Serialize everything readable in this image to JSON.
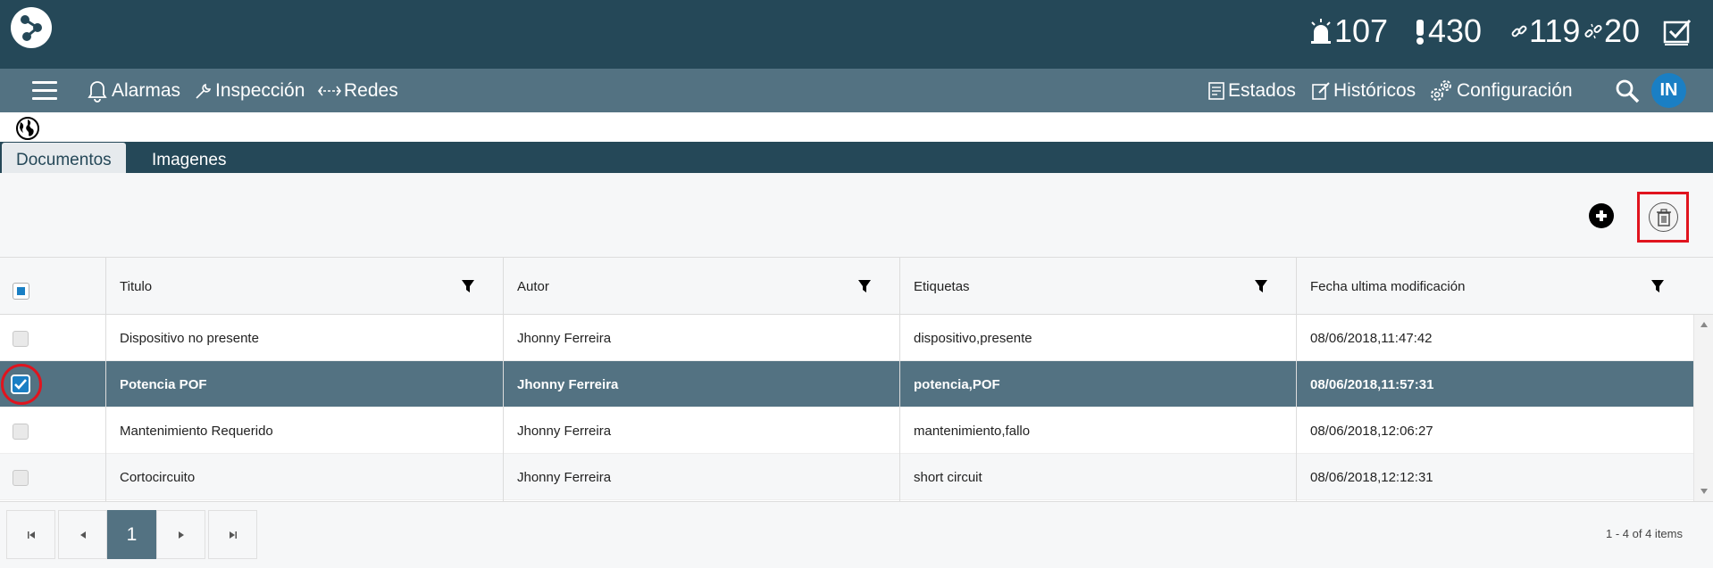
{
  "header": {
    "stats": {
      "alarms": "107",
      "warnings": "430",
      "linked": "119",
      "unlinked": "20"
    }
  },
  "nav": {
    "alarmas": "Alarmas",
    "inspeccion": "Inspección",
    "redes": "Redes",
    "estados": "Estados",
    "historicos": "Históricos",
    "configuracion": "Configuración",
    "avatar_initials": "IN"
  },
  "tabs": {
    "documentos": "Documentos",
    "imagenes": "Imagenes"
  },
  "grid": {
    "columns": {
      "titulo": "Titulo",
      "autor": "Autor",
      "etiquetas": "Etiquetas",
      "fecha": "Fecha ultima modificación"
    },
    "rows": [
      {
        "titulo": "Dispositivo no presente",
        "autor": "Jhonny Ferreira",
        "etiquetas": "dispositivo,presente",
        "fecha": "08/06/2018,11:47:42",
        "selected": false
      },
      {
        "titulo": "Potencia POF",
        "autor": "Jhonny Ferreira",
        "etiquetas": "potencia,POF",
        "fecha": "08/06/2018,11:57:31",
        "selected": true
      },
      {
        "titulo": "Mantenimiento Requerido",
        "autor": "Jhonny Ferreira",
        "etiquetas": "mantenimiento,fallo",
        "fecha": "08/06/2018,12:06:27",
        "selected": false
      },
      {
        "titulo": "Cortocircuito",
        "autor": "Jhonny Ferreira",
        "etiquetas": "short circuit",
        "fecha": "08/06/2018,12:12:31",
        "selected": false
      }
    ]
  },
  "pager": {
    "current_page": "1",
    "info": "1 - 4 of 4 items"
  },
  "colors": {
    "header_bg": "#254858",
    "nav_bg": "#537282",
    "selected_row": "#537282",
    "accent": "#1a7fc4",
    "highlight": "#e0141e"
  },
  "icons": [
    "app-logo-icon",
    "alarm-siren-icon",
    "exclamation-icon",
    "link-icon",
    "unlink-icon",
    "checklist-icon",
    "hamburger-icon",
    "bell-icon",
    "wrench-icon",
    "network-arrows-icon",
    "document-icon",
    "edit-icon",
    "gears-icon",
    "search-icon",
    "globe-icon",
    "add-circle-icon",
    "trash-icon",
    "filter-icon",
    "first-page-icon",
    "prev-page-icon",
    "next-page-icon",
    "last-page-icon"
  ]
}
